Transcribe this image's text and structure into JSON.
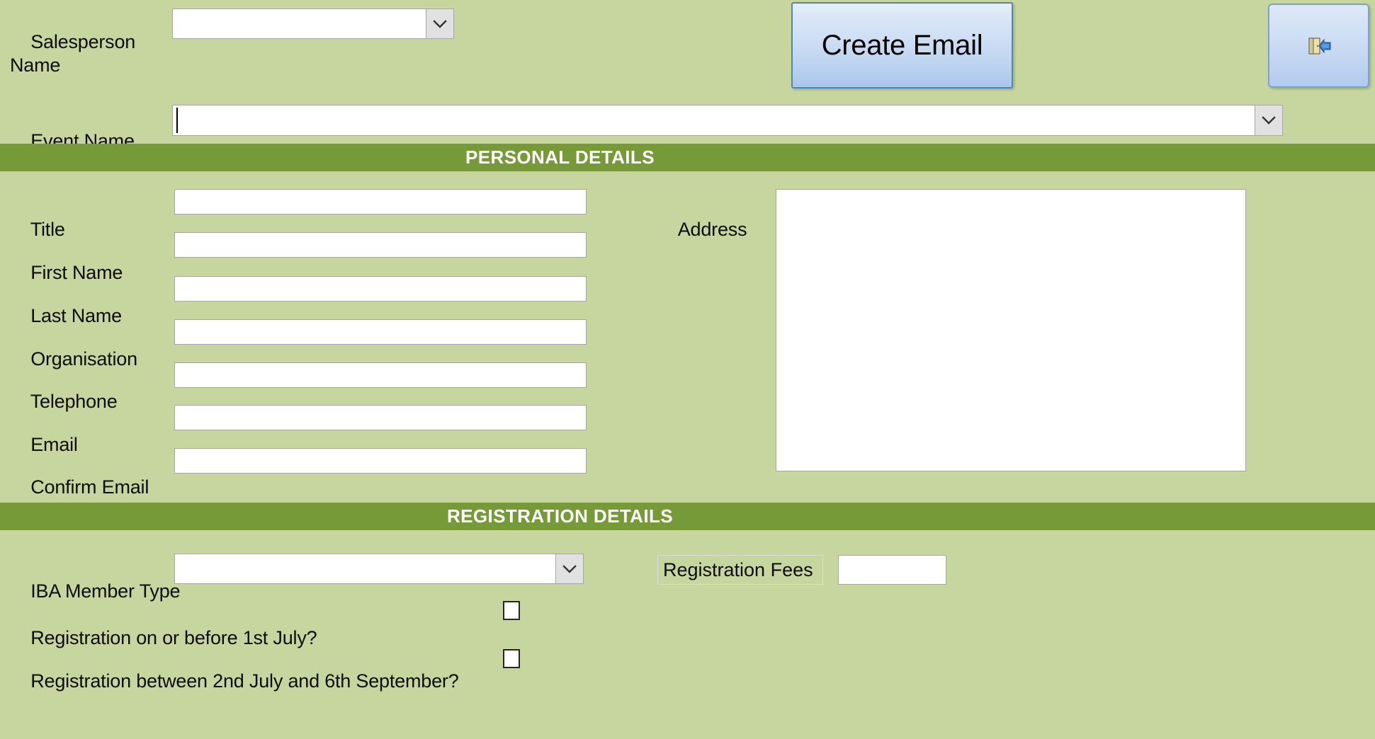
{
  "theme": {
    "background_color": "#c6d69e",
    "section_header_color": "#769a38",
    "section_header_text_color": "#ffffff",
    "button_border_color": "#5585b5",
    "input_background": "#ffffff",
    "input_border": "#a6a6a6",
    "text_color": "#0d0d0d"
  },
  "top": {
    "salesperson_label": "Salesperson\nName",
    "salesperson_value": "",
    "event_label": "Event Name",
    "event_value": "",
    "create_email_button": "Create Email",
    "exit_button_icon": "exit-door-icon"
  },
  "personal_details": {
    "section_title": "PERSONAL DETAILS",
    "fields": [
      {
        "label": "Title",
        "value": ""
      },
      {
        "label": "First Name",
        "value": ""
      },
      {
        "label": "Last Name",
        "value": ""
      },
      {
        "label": "Organisation",
        "value": ""
      },
      {
        "label": "Telephone",
        "value": ""
      },
      {
        "label": "Email",
        "value": ""
      },
      {
        "label": "Confirm Email",
        "value": ""
      }
    ],
    "address_label": "Address",
    "address_value": ""
  },
  "registration_details": {
    "section_title": "REGISTRATION DETAILS",
    "member_type_label": "IBA Member Type",
    "member_type_value": "",
    "registration_fees_label": "Registration Fees",
    "registration_fees_value": "",
    "checkbox_rows": [
      {
        "label": "Registration on or before 1st July?",
        "checked": false
      },
      {
        "label": "Registration between 2nd July and 6th September?",
        "checked": false
      }
    ]
  }
}
